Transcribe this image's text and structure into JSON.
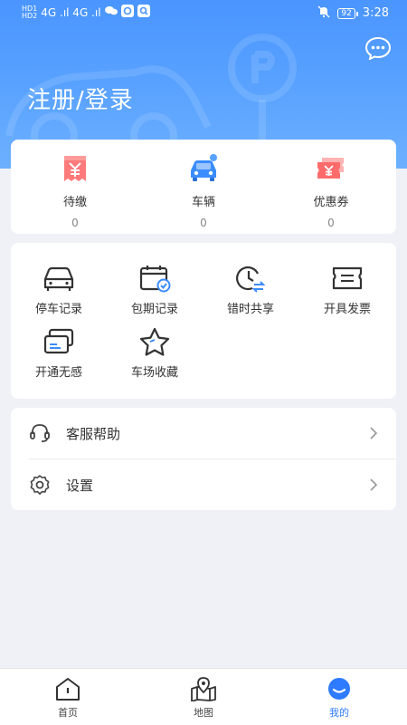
{
  "status_bar": {
    "left_text": "4G .ıl 4G .ıl",
    "battery": "92",
    "time": "3:28"
  },
  "header": {
    "login_label": "注册/登录",
    "chat_icon": "chat-bubble-icon"
  },
  "stats": [
    {
      "label": "待缴",
      "value": "0",
      "icon": "bill-icon"
    },
    {
      "label": "车辆",
      "value": "0",
      "icon": "car-icon"
    },
    {
      "label": "优惠券",
      "value": "0",
      "icon": "coupon-icon"
    }
  ],
  "services": [
    {
      "label": "停车记录",
      "icon": "car-outline-icon"
    },
    {
      "label": "包期记录",
      "icon": "calendar-check-icon"
    },
    {
      "label": "错时共享",
      "icon": "clock-swap-icon"
    },
    {
      "label": "开具发票",
      "icon": "invoice-icon"
    },
    {
      "label": "开通无感",
      "icon": "cards-icon"
    },
    {
      "label": "车场收藏",
      "icon": "star-icon"
    }
  ],
  "menu": [
    {
      "label": "客服帮助",
      "icon": "headset-icon"
    },
    {
      "label": "设置",
      "icon": "gear-icon"
    }
  ],
  "bottom_nav": [
    {
      "label": "首页",
      "icon": "home-icon",
      "active": false
    },
    {
      "label": "地图",
      "icon": "map-pin-icon",
      "active": false
    },
    {
      "label": "我的",
      "icon": "profile-icon",
      "active": true
    }
  ],
  "colors": {
    "accent": "#2e7bff",
    "header_blue": "#4a95ff",
    "bill_red": "#ff6a6a",
    "car_blue": "#3b8cff"
  }
}
